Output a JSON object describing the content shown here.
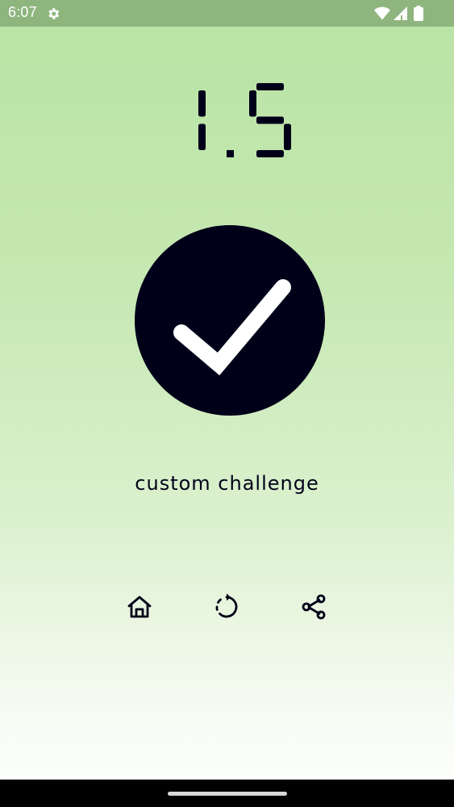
{
  "status_bar": {
    "time": "6:07",
    "icons": [
      "gear-icon",
      "wifi-icon",
      "signal-icon",
      "battery-icon"
    ]
  },
  "score": {
    "value": "1.5"
  },
  "result": {
    "icon": "check-icon"
  },
  "challenge": {
    "label": "custom challenge"
  },
  "actions": [
    {
      "icon": "home-icon"
    },
    {
      "icon": "retry-icon"
    },
    {
      "icon": "share-icon"
    }
  ],
  "colors": {
    "accent": "#000019",
    "status_bar": "#8fb57f",
    "background_top": "#b9e3a4",
    "background_bottom": "#ffffff"
  }
}
